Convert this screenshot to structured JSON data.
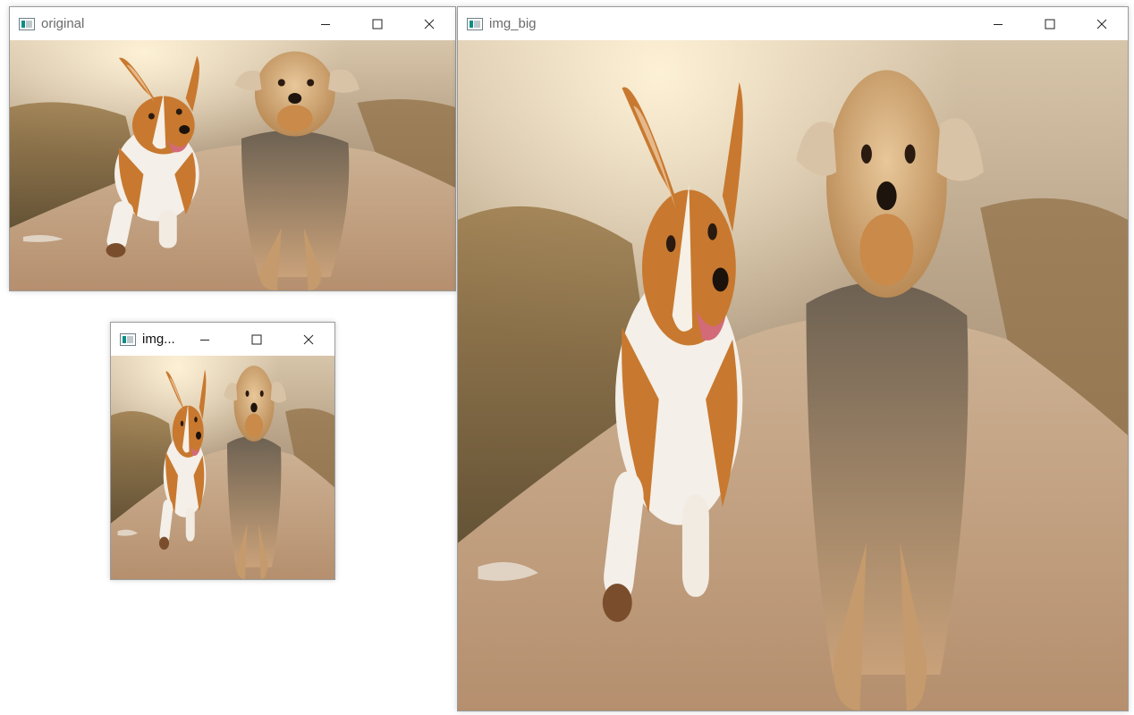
{
  "windows": {
    "original": {
      "title": "original",
      "icon": "opencv-window-icon",
      "image": "two-dogs-running-photo"
    },
    "small": {
      "title": "img...",
      "icon": "opencv-window-icon",
      "image": "two-dogs-running-photo"
    },
    "big": {
      "title": "img_big",
      "icon": "opencv-window-icon",
      "image": "two-dogs-running-photo"
    }
  },
  "controls": {
    "minimize": "minimize-icon",
    "maximize": "maximize-icon",
    "close": "close-icon"
  }
}
